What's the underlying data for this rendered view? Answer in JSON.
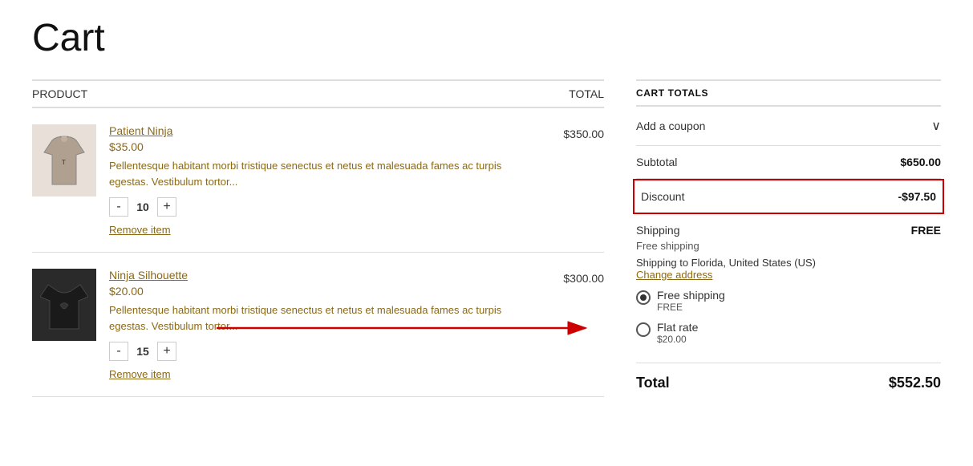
{
  "page": {
    "title": "Cart"
  },
  "cart_header": {
    "product_label": "PRODUCT",
    "total_label": "TOTAL"
  },
  "items": [
    {
      "id": "patient-ninja",
      "name": "Patient Ninja",
      "price": "$35.00",
      "description": "Pellentesque habitant morbi tristique senectus et netus et malesuada fames ac turpis egestas. Vestibulum tortor...",
      "quantity": 10,
      "total": "$350.00",
      "remove_label": "Remove item",
      "image_type": "hoodie"
    },
    {
      "id": "ninja-silhouette",
      "name": "Ninja Silhouette",
      "price": "$20.00",
      "description": "Pellentesque habitant morbi tristique senectus et netus et malesuada fames ac turpis egestas. Vestibulum tortor...",
      "quantity": 15,
      "total": "$300.00",
      "remove_label": "Remove item",
      "image_type": "tshirt"
    }
  ],
  "cart_totals": {
    "title": "CART TOTALS",
    "coupon_label": "Add a coupon",
    "coupon_chevron": "∨",
    "subtotal_label": "Subtotal",
    "subtotal_value": "$650.00",
    "discount_label": "Discount",
    "discount_value": "-$97.50",
    "shipping_label": "Shipping",
    "shipping_value": "FREE",
    "free_shipping_label": "Free shipping",
    "shipping_address_text": "Shipping to Florida, United States (US)",
    "change_address_label": "Change address",
    "shipping_options": [
      {
        "label": "Free shipping",
        "sub": "FREE",
        "selected": true
      },
      {
        "label": "Flat rate",
        "sub": "$20.00",
        "selected": false
      }
    ],
    "total_label": "Total",
    "total_value": "$552.50"
  }
}
